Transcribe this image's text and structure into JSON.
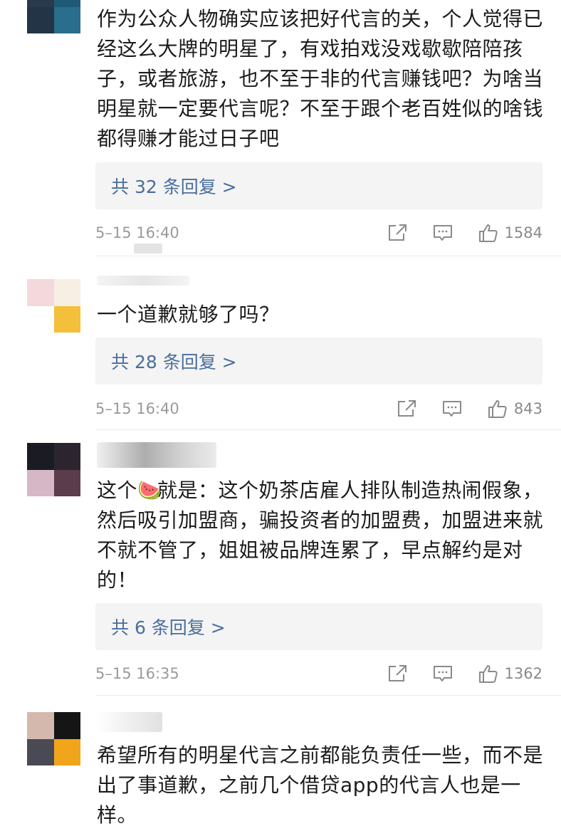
{
  "comments": [
    {
      "text": "作为公众人物确实应该把好代言的关，个人觉得已经这么大牌的明星了，有戏拍戏没戏歇歇陪陪孩子，或者旅游，也不至于非的代言赚钱吧？为啥当明星就一定要代言呢？不至于跟个老百姓似的啥钱都得赚才能过日子吧",
      "replies": "共 32 条回复 >",
      "time": "5–15 16:40",
      "likes": "1584"
    },
    {
      "text": "一个道歉就够了吗？",
      "replies": "共 28 条回复 >",
      "time": "5–15 16:40",
      "likes": "843"
    },
    {
      "text_before": "这个",
      "emoji": "🍉",
      "text_after": "就是：这个奶茶店雇人排队制造热闹假象，然后吸引加盟商，骗投资者的加盟费，加盟进来就不就不管了，姐姐被品牌连累了，早点解约是对的！",
      "replies": "共 6 条回复 >",
      "time": "5–15 16:35",
      "likes": "1362"
    },
    {
      "text": "希望所有的明星代言之前都能负责任一些，而不是出了事道歉，之前几个借贷app的代言人也是一样。"
    }
  ],
  "icons": {
    "share": "share-icon",
    "comment": "comment-icon",
    "like": "thumbs-up-icon"
  },
  "colors": {
    "reply_link": "#4a6e9c",
    "meta_text": "#9a9a9a",
    "reply_bg": "#f4f4f4"
  }
}
